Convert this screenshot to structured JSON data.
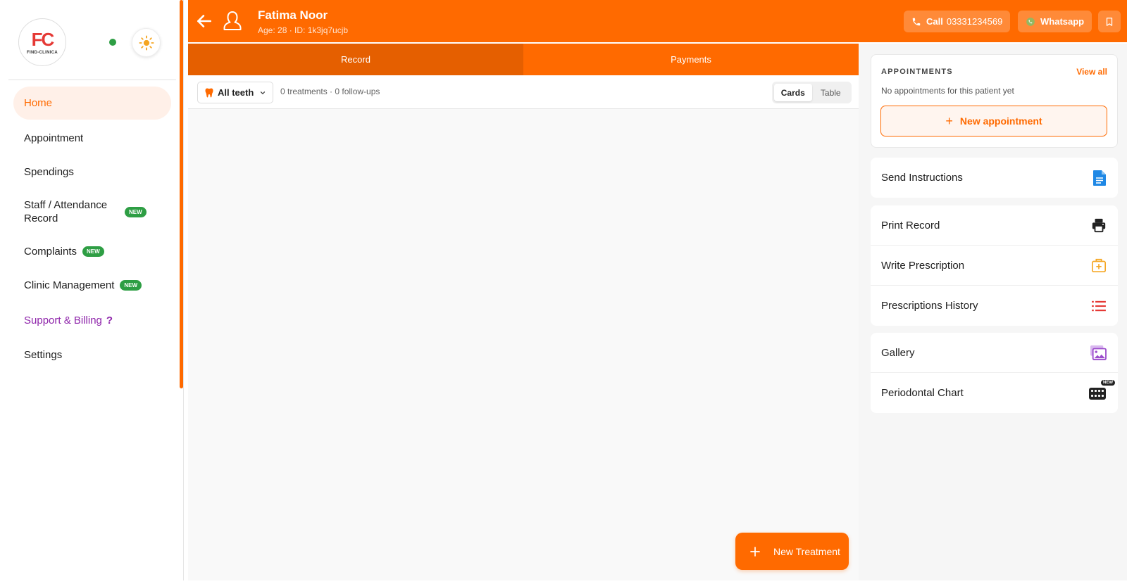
{
  "sidebar": {
    "logo_mark": "FC",
    "logo_text": "FIND-CLINICA",
    "items": [
      {
        "label": "Home"
      },
      {
        "label": "Appointment"
      },
      {
        "label": "Spendings"
      },
      {
        "label": "Staff / Attendance Record",
        "line1": "Staff / Attendance",
        "line2": "Record",
        "badge": "NEW"
      },
      {
        "label": "Complaints",
        "badge": "NEW"
      },
      {
        "label": "Clinic Management",
        "badge": "NEW"
      },
      {
        "label": "Support & Billing",
        "suffix": "?"
      },
      {
        "label": "Settings"
      }
    ]
  },
  "header": {
    "patient_name": "Fatima Noor",
    "patient_meta": "Age: 28 · ID: 1k3jq7ucjb",
    "call_label": "Call",
    "call_number": "03331234569",
    "whatsapp_label": "Whatsapp"
  },
  "tabs": [
    {
      "label": "Record",
      "active": true
    },
    {
      "label": "Payments",
      "active": false
    }
  ],
  "filter": {
    "teeth_select": "All teeth",
    "summary": "0 treatments · 0 follow-ups",
    "view_options": [
      "Cards",
      "Table"
    ],
    "active_view": "Cards"
  },
  "fab": {
    "label": "New Treatment"
  },
  "appointments": {
    "title": "APPOINTMENTS",
    "view_all": "View all",
    "empty_text": "No appointments for this patient yet",
    "new_button": "New appointment"
  },
  "actions": {
    "group1": [
      {
        "label": "Send Instructions",
        "icon": "document-icon"
      }
    ],
    "group2": [
      {
        "label": "Print Record",
        "icon": "printer-icon"
      },
      {
        "label": "Write Prescription",
        "icon": "medkit-icon"
      },
      {
        "label": "Prescriptions History",
        "icon": "list-icon"
      }
    ],
    "group3": [
      {
        "label": "Gallery",
        "icon": "gallery-icon"
      },
      {
        "label": "Periodontal Chart",
        "icon": "teeth-grid-icon",
        "badge": "NEW"
      }
    ]
  },
  "colors": {
    "primary": "#ff6a00",
    "primary_dark": "#e55f00",
    "badge_green": "#2e9e44",
    "purple": "#8e24aa",
    "doc_blue": "#1f88e5",
    "rx_amber": "#f5a623",
    "list_red": "#e53935",
    "gallery_purple": "#9c4dcc"
  }
}
